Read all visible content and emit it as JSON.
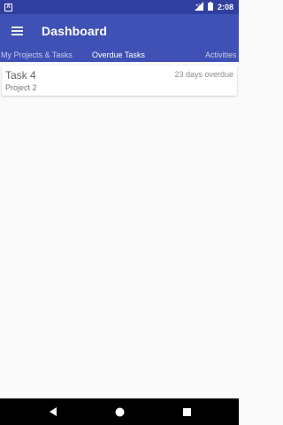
{
  "status_bar": {
    "time": "2:08",
    "app_icon_letter": "A",
    "icons": [
      "app-notification-icon",
      "signal-icon",
      "battery-icon"
    ]
  },
  "toolbar": {
    "title": "Dashboard",
    "menu_icon": "hamburger-menu-icon"
  },
  "tabs": [
    {
      "label": "My Projects & Tasks",
      "active": false
    },
    {
      "label": "Overdue Tasks",
      "active": true
    },
    {
      "label": "Activities",
      "active": false
    }
  ],
  "tasks": [
    {
      "title": "Task 4",
      "project": "Project 2",
      "status": "23 days overdue"
    }
  ],
  "nav_bar": {
    "icons": [
      "back-icon",
      "home-icon",
      "recents-icon"
    ]
  },
  "colors": {
    "status_bar": "#303f9f",
    "primary": "#3f51b5",
    "background": "#fafafa",
    "nav_bar": "#000000"
  }
}
